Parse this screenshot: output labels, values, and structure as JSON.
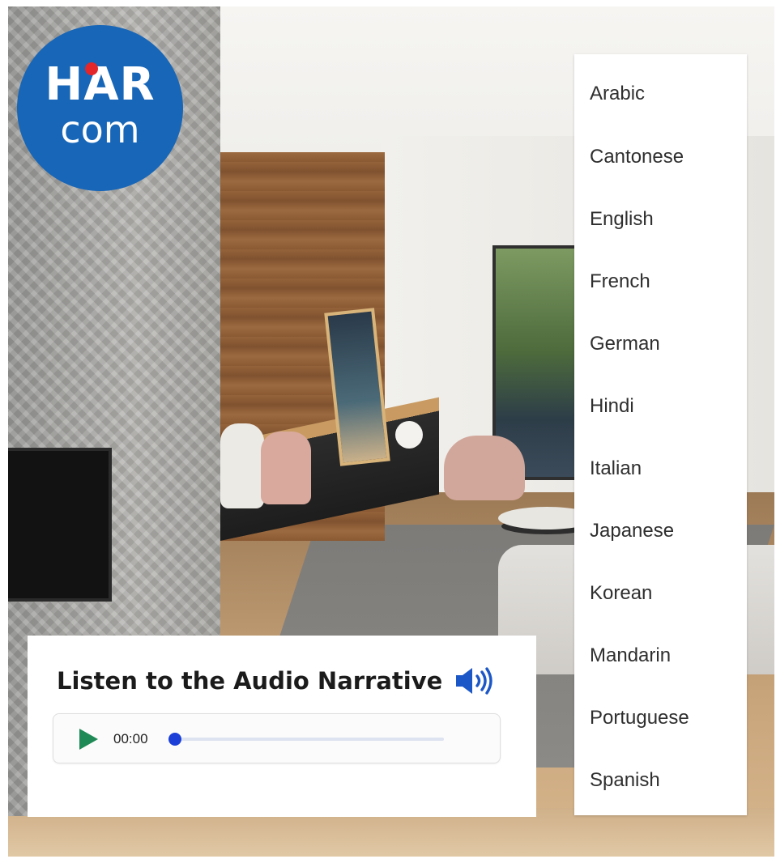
{
  "logo": {
    "top_text": "HAR",
    "bottom_text": "com",
    "color": "#1766b8",
    "dot_color": "#e3262a"
  },
  "languages": [
    "Arabic",
    "Cantonese",
    "English",
    "French",
    "German",
    "Hindi",
    "Italian",
    "Japanese",
    "Korean",
    "Mandarin",
    "Portuguese",
    "Spanish"
  ],
  "audio": {
    "title": "Listen to the Audio Narrative",
    "speaker_icon": "speaker-volume-icon",
    "play_icon": "play-icon",
    "time": "00:00",
    "progress": 0,
    "accent_color": "#1c3fd8",
    "play_color": "#1f8a55"
  }
}
